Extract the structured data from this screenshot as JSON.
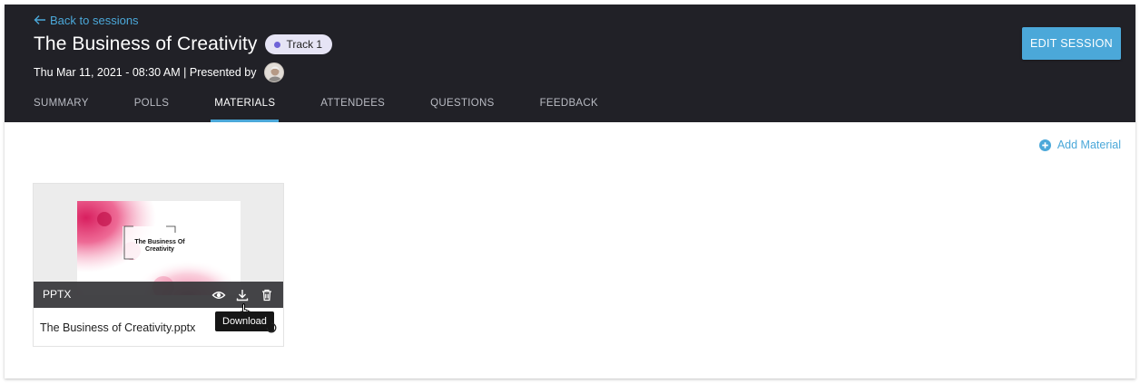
{
  "nav": {
    "back_label": "Back to sessions"
  },
  "session": {
    "title": "The Business of Creativity",
    "track": "Track 1",
    "datetime_presenter": "Thu Mar 11, 2021 - 08:30 AM | Presented by"
  },
  "tabs": [
    {
      "label": "SUMMARY",
      "active": false
    },
    {
      "label": "POLLS",
      "active": false
    },
    {
      "label": "MATERIALS",
      "active": true
    },
    {
      "label": "ATTENDEES",
      "active": false
    },
    {
      "label": "QUESTIONS",
      "active": false
    },
    {
      "label": "FEEDBACK",
      "active": false
    }
  ],
  "actions": {
    "edit_session": "EDIT SESSION",
    "add_material": "Add Material"
  },
  "materials": [
    {
      "slide_title": "The Business  Of Creativity",
      "file_type": "PPTX",
      "file_name": "The Business of Creativity.pptx",
      "tooltip": "Download",
      "icons": [
        "eye-icon",
        "download-icon",
        "trash-icon"
      ]
    }
  ],
  "colors": {
    "header_bg": "#212127",
    "accent": "#4ba8d9",
    "track_badge_bg": "#e6e4f5",
    "track_dot": "#6f63d8"
  }
}
